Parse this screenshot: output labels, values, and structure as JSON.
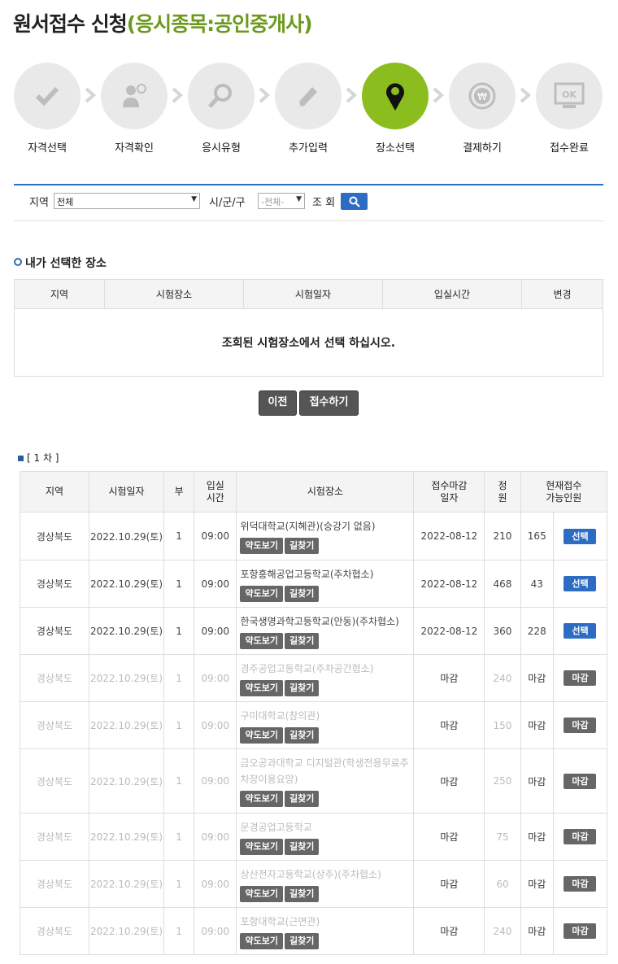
{
  "header": {
    "title_main": "원서접수 신청",
    "title_sub": "(응시종목:공인중개사)"
  },
  "steps": [
    {
      "label": "자격선택",
      "icon": "check-icon"
    },
    {
      "label": "자격확인",
      "icon": "user-icon"
    },
    {
      "label": "응시유형",
      "icon": "magnifier-icon"
    },
    {
      "label": "추가입력",
      "icon": "pencil-icon"
    },
    {
      "label": "장소선택",
      "icon": "map-pin-icon",
      "active": true
    },
    {
      "label": "결제하기",
      "icon": "won-coin-icon"
    },
    {
      "label": "접수완료",
      "icon": "ok-monitor-icon"
    }
  ],
  "search": {
    "region_label": "지역",
    "region_value": "전체",
    "city_label": "시/군/구",
    "city_value": "-전체-",
    "query_label": "조 회"
  },
  "selected": {
    "title": "내가 선택한 장소",
    "headers": [
      "지역",
      "시험장소",
      "시험일자",
      "입실시간",
      "변경"
    ],
    "empty_msg": "조회된 시험장소에서 선택 하십시오."
  },
  "actions": {
    "prev": "이전",
    "submit": "접수하기"
  },
  "round": "[ 1 차 ]",
  "list": {
    "headers": [
      "지역",
      "시험일자",
      "부",
      "입실\n시간",
      "시험장소",
      "접수마감\n일자",
      "정\n원",
      "현재접수\n가능인원"
    ],
    "map_label": "약도보기",
    "route_label": "길찾기",
    "select_label": "선택",
    "closed_label": "마감",
    "rows": [
      {
        "region": "경상북도",
        "date": "2022.10.29(토)",
        "part": "1",
        "time": "09:00",
        "place": "위덕대학교(지혜관)(승강기 없음)",
        "deadline": "2022-08-12",
        "capacity": "210",
        "remain": "165",
        "closed": false
      },
      {
        "region": "경상북도",
        "date": "2022.10.29(토)",
        "part": "1",
        "time": "09:00",
        "place": "포항흥해공업고등학교(주차협소)",
        "deadline": "2022-08-12",
        "capacity": "468",
        "remain": "43",
        "closed": false
      },
      {
        "region": "경상북도",
        "date": "2022.10.29(토)",
        "part": "1",
        "time": "09:00",
        "place": "한국생명과학고등학교(안동)(주차협소)",
        "deadline": "2022-08-12",
        "capacity": "360",
        "remain": "228",
        "closed": false
      },
      {
        "region": "경상북도",
        "date": "2022.10.29(토)",
        "part": "1",
        "time": "09:00",
        "place": "경주공업고등학교(주차공간협소)",
        "deadline": "마감",
        "capacity": "240",
        "remain": "마감",
        "closed": true
      },
      {
        "region": "경상북도",
        "date": "2022.10.29(토)",
        "part": "1",
        "time": "09:00",
        "place": "구미대학교(창의관)",
        "deadline": "마감",
        "capacity": "150",
        "remain": "마감",
        "closed": true
      },
      {
        "region": "경상북도",
        "date": "2022.10.29(토)",
        "part": "1",
        "time": "09:00",
        "place": "금오공과대학교 디지털관(학생전용무료주차장이용요망)",
        "deadline": "마감",
        "capacity": "250",
        "remain": "마감",
        "closed": true
      },
      {
        "region": "경상북도",
        "date": "2022.10.29(토)",
        "part": "1",
        "time": "09:00",
        "place": "문경공업고등학교",
        "deadline": "마감",
        "capacity": "75",
        "remain": "마감",
        "closed": true
      },
      {
        "region": "경상북도",
        "date": "2022.10.29(토)",
        "part": "1",
        "time": "09:00",
        "place": "상산전자고등학교(상주)(주차협소)",
        "deadline": "마감",
        "capacity": "60",
        "remain": "마감",
        "closed": true
      },
      {
        "region": "경상북도",
        "date": "2022.10.29(토)",
        "part": "1",
        "time": "09:00",
        "place": "포항대학교(근면관)",
        "deadline": "마감",
        "capacity": "240",
        "remain": "마감",
        "closed": true
      }
    ]
  }
}
